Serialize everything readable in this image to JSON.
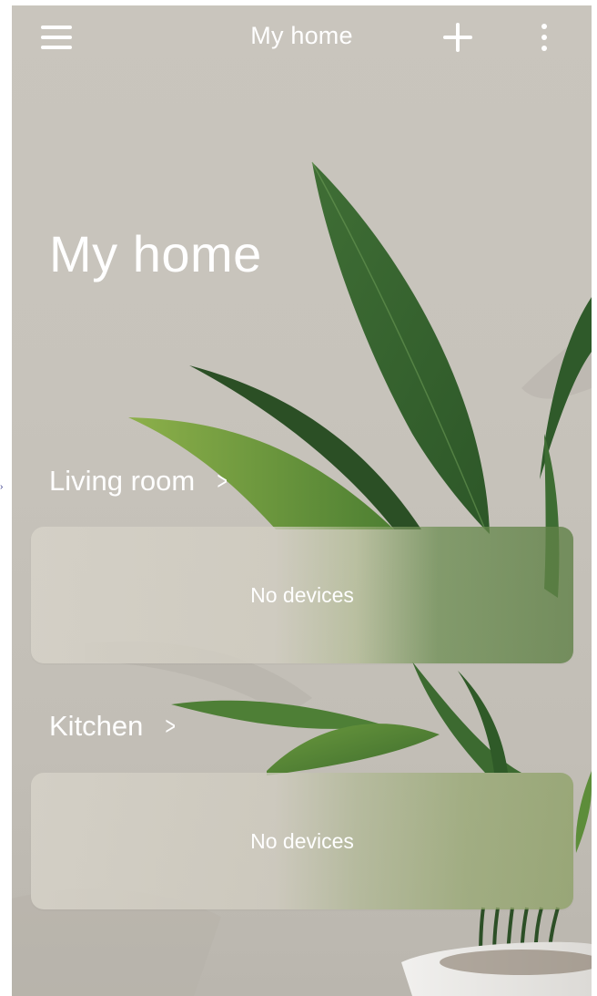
{
  "app": {
    "title": "My home"
  },
  "header": {
    "menu_icon": "hamburger-menu-icon",
    "add_icon": "plus-icon",
    "more_icon": "vertical-ellipsis-icon"
  },
  "home": {
    "title": "My home"
  },
  "rooms": [
    {
      "name": "Living room",
      "chevron": ">",
      "status": "No devices"
    },
    {
      "name": "Kitchen",
      "chevron": ">",
      "status": "No devices"
    }
  ],
  "colors": {
    "text": "#ffffff",
    "background": "#c7c3bb",
    "plant_green": "#4f7a3c"
  }
}
